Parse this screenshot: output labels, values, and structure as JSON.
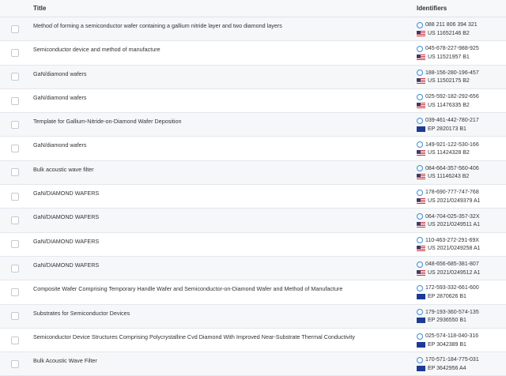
{
  "header": {
    "title": "Title",
    "identifiers": "Identifiers"
  },
  "rows": [
    {
      "title": "Method of forming a semiconductor wafer containing a gallium nitride layer and two diamond layers",
      "lens": "088 211 806 394 321",
      "pub": "US 11652146 B2",
      "flag": "us"
    },
    {
      "title": "Semiconductor device and method of manufacture",
      "lens": "045-678-227-988-925",
      "pub": "US 11521957 B1",
      "flag": "us"
    },
    {
      "title": "GaN/diamond wafers",
      "lens": "188-156-280-196-457",
      "pub": "US 11502175 B2",
      "flag": "us"
    },
    {
      "title": "GaN/diamond wafers",
      "lens": "025-592-182-292-656",
      "pub": "US 11476335 B2",
      "flag": "us"
    },
    {
      "title": "Template for Gallium-Nitride-on-Diamond Wafer Deposition",
      "lens": "039-461-442-780-217",
      "pub": "EP 2820173 B1",
      "flag": "eu"
    },
    {
      "title": "GaN/diamond wafers",
      "lens": "149-921-122-530-166",
      "pub": "US 11424328 B2",
      "flag": "us"
    },
    {
      "title": "Bulk acoustic wave filter",
      "lens": "084-664-357-560-406",
      "pub": "US 11146243 B2",
      "flag": "us"
    },
    {
      "title": "GaN/DIAMOND WAFERS",
      "lens": "178-690-777-747-768",
      "pub": "US 2021/0249379 A1",
      "flag": "us"
    },
    {
      "title": "GaN/DIAMOND WAFERS",
      "lens": "064-704-025-357-32X",
      "pub": "US 2021/0249511 A1",
      "flag": "us"
    },
    {
      "title": "GaN/DIAMOND WAFERS",
      "lens": "110-463-272-291-69X",
      "pub": "US 2021/0249258 A1",
      "flag": "us"
    },
    {
      "title": "GaN/DIAMOND WAFERS",
      "lens": "048-656-685-381-807",
      "pub": "US 2021/0249512 A1",
      "flag": "us"
    },
    {
      "title": "Composite Wafer Comprising Temporary Handle Wafer and Semiconductor-on-Diamond Wafer and Method of Manufacture",
      "lens": "172-593-332-661-600",
      "pub": "EP 2870626 B1",
      "flag": "eu"
    },
    {
      "title": "Substrates for Semiconductor Devices",
      "lens": "179-193-360-574-135",
      "pub": "EP 2936550 B1",
      "flag": "eu"
    },
    {
      "title": "Semiconductor Device Structures Comprising Polycrystalline Cvd Diamond With Improved Near-Substrate Thermal Conductivity",
      "lens": "025-574-118-040-316",
      "pub": "EP 3042389 B1",
      "flag": "eu"
    },
    {
      "title": "Bulk Acoustic Wave Filter",
      "lens": "170-571-184-775-031",
      "pub": "EP 3642956 A4",
      "flag": "eu"
    }
  ]
}
